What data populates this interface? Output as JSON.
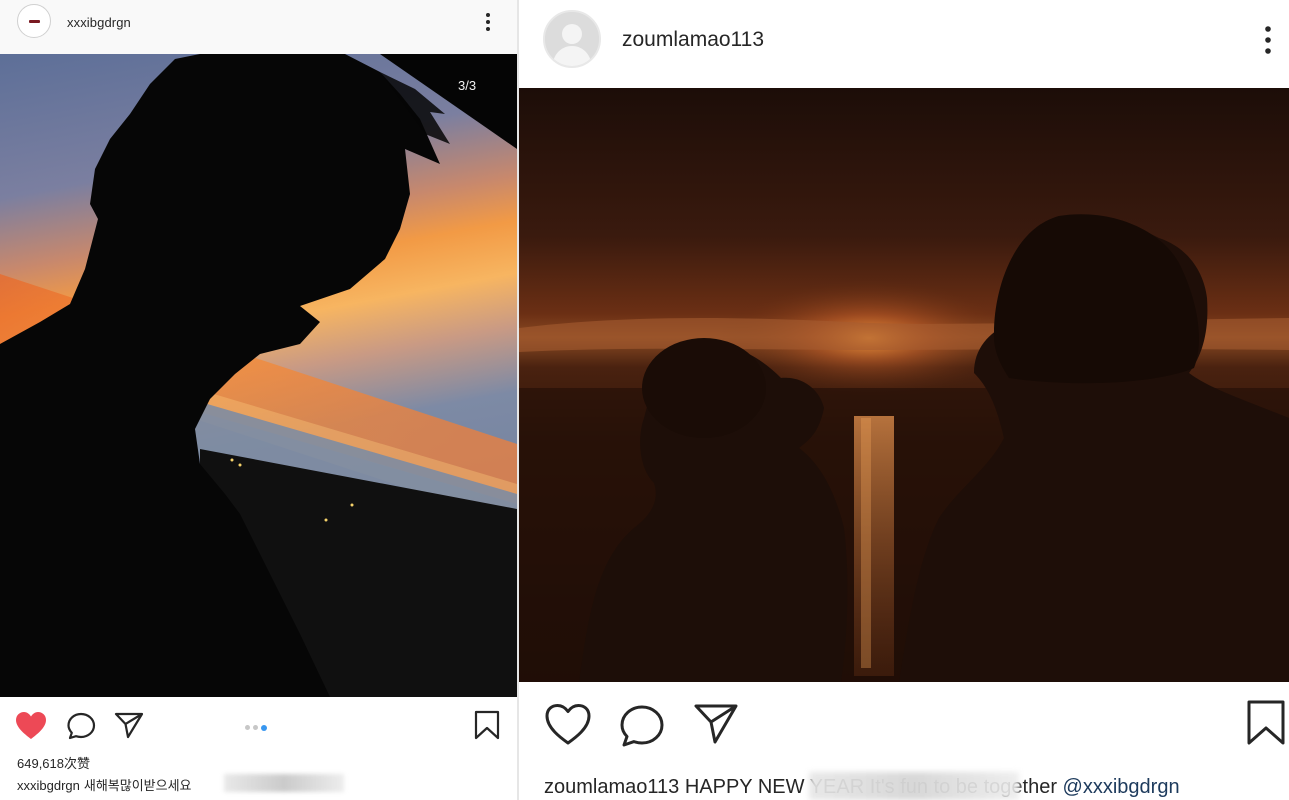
{
  "left_post": {
    "username": "xxxibgdrgn",
    "photo_counter": "3/3",
    "likes": "649,618次赞",
    "caption_user": "xxxibgdrgn",
    "caption_text": "새해복많이받으세요",
    "icons": {
      "avatar": "avatar-icon",
      "more": "more-vertical-icon",
      "like": "heart-filled-icon",
      "comment": "comment-icon",
      "share": "paper-plane-icon",
      "carousel": "carousel-dots-icon",
      "save": "bookmark-icon"
    },
    "colors": {
      "like": "#ed4956",
      "active_dot": "#3897f0"
    }
  },
  "right_post": {
    "username": "zoumlamao113",
    "caption_user": "zoumlamao113",
    "caption_text": "HAPPY NEW YEAR It's fun to be together",
    "caption_mention": "@xxxibgdrgn",
    "icons": {
      "avatar": "avatar-icon",
      "more": "more-vertical-icon",
      "like": "heart-outline-icon",
      "comment": "comment-icon",
      "share": "paper-plane-icon",
      "save": "bookmark-icon"
    },
    "colors": {
      "mention": "#1d3a5c"
    }
  }
}
